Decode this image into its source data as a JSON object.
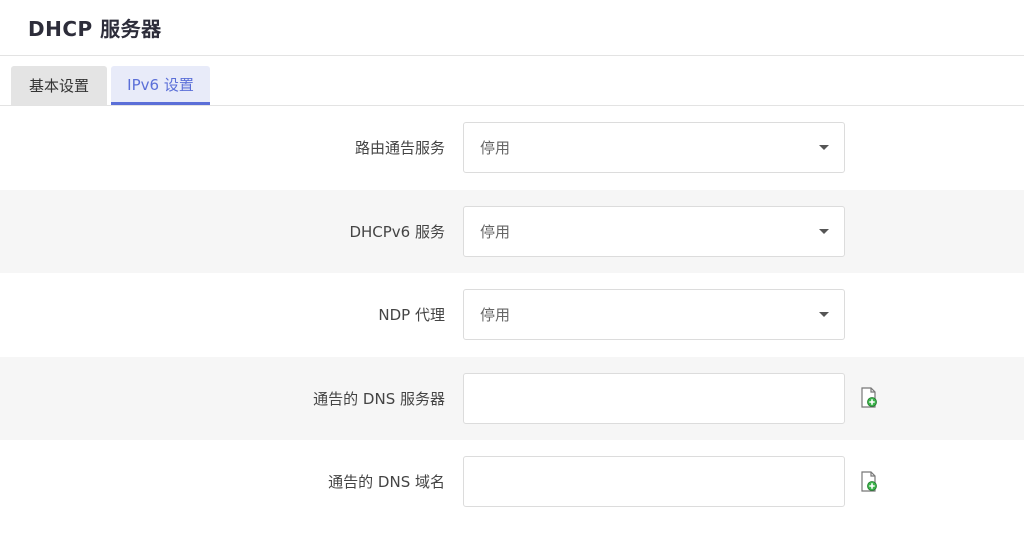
{
  "header": {
    "title": "DHCP 服务器"
  },
  "tabs": [
    {
      "label": "基本设置",
      "active": false
    },
    {
      "label": "IPv6 设置",
      "active": true
    }
  ],
  "fields": [
    {
      "label": "路由通告服务",
      "type": "select",
      "value": "停用"
    },
    {
      "label": "DHCPv6 服务",
      "type": "select",
      "value": "停用"
    },
    {
      "label": "NDP 代理",
      "type": "select",
      "value": "停用"
    },
    {
      "label": "通告的 DNS 服务器",
      "type": "dynlist",
      "value": "",
      "icon": "add-item-icon"
    },
    {
      "label": "通告的 DNS 域名",
      "type": "dynlist",
      "value": "",
      "icon": "add-item-icon"
    }
  ],
  "colors": {
    "accent": "#5b6fd8",
    "add_icon_green": "#3cb44b"
  }
}
